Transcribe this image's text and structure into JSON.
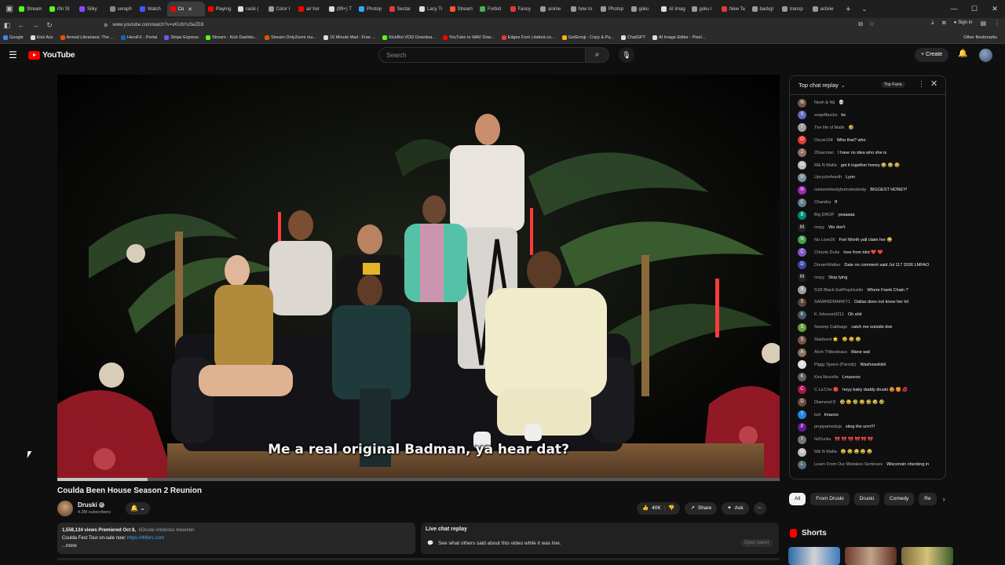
{
  "browser": {
    "tabs": [
      {
        "label": "Stream",
        "color": "#53fc18",
        "active": false
      },
      {
        "label": "r0n St",
        "color": "#53fc18",
        "active": false
      },
      {
        "label": "Silky",
        "color": "#9146ff",
        "active": false
      },
      {
        "label": "seraph",
        "color": "#888888",
        "active": false
      },
      {
        "label": "Watch",
        "color": "#3d5afe",
        "active": false
      },
      {
        "label": "Co",
        "color": "#ff0000",
        "active": true
      },
      {
        "label": "Playing",
        "color": "#ff0000",
        "active": false
      },
      {
        "label": "racki (",
        "color": "#dddddd",
        "active": false
      },
      {
        "label": "Color I",
        "color": "#999999",
        "active": false
      },
      {
        "label": "air hor",
        "color": "#ff0000",
        "active": false
      },
      {
        "label": "(99+) T",
        "color": "#dddddd",
        "active": false
      },
      {
        "label": "Photop",
        "color": "#31a8ff",
        "active": false
      },
      {
        "label": "Sectar",
        "color": "#e53935",
        "active": false
      },
      {
        "label": "Lacy Ti",
        "color": "#dddddd",
        "active": false
      },
      {
        "label": "Stream",
        "color": "#ff5722",
        "active": false
      },
      {
        "label": "Forbid",
        "color": "#4caf50",
        "active": false
      },
      {
        "label": "Fancy",
        "color": "#e53935",
        "active": false
      },
      {
        "label": "anime",
        "color": "#999999",
        "active": false
      },
      {
        "label": "how to",
        "color": "#999999",
        "active": false
      },
      {
        "label": "Photop",
        "color": "#999999",
        "active": false
      },
      {
        "label": "goku",
        "color": "#999999",
        "active": false
      },
      {
        "label": "AI Imag",
        "color": "#dddddd",
        "active": false
      },
      {
        "label": "goku l",
        "color": "#999999",
        "active": false
      },
      {
        "label": "New Ta",
        "color": "#e53935",
        "active": false
      },
      {
        "label": "backgr",
        "color": "#999999",
        "active": false
      },
      {
        "label": "transp",
        "color": "#999999",
        "active": false
      },
      {
        "label": "activie",
        "color": "#999999",
        "active": false
      }
    ],
    "url": "www.youtube.com/watch?v=vKUbYuSeZE8",
    "signin_label": "Sign in",
    "bookmarks": [
      {
        "label": "Google",
        "color": "#4285f4"
      },
      {
        "label": "Kick Ass",
        "color": "#dddddd"
      },
      {
        "label": "Armed Librarians: The ...",
        "color": "#e65100"
      },
      {
        "label": "HeroFX - Portal",
        "color": "#1565c0"
      },
      {
        "label": "Stripe Express",
        "color": "#635bff"
      },
      {
        "label": "Stream - Kick Dashbo...",
        "color": "#53fc18"
      },
      {
        "label": "Stream OnlyZenni mu...",
        "color": "#e65100"
      },
      {
        "label": "10 Minute Mail - Free ...",
        "color": "#dddddd"
      },
      {
        "label": "KickBot VOD Downloa...",
        "color": "#53fc18"
      },
      {
        "label": "YouTube to WAV Dow...",
        "color": "#ff0000"
      },
      {
        "label": "Edges Font | dafont.co...",
        "color": "#e53935"
      },
      {
        "label": "GetEmoji - Copy & Pa...",
        "color": "#ffb300"
      },
      {
        "label": "ChatGPT",
        "color": "#dddddd"
      },
      {
        "label": "AI Image Editor - Pixel...",
        "color": "#dddddd"
      }
    ],
    "other_bookmarks": "Other Bookmarks"
  },
  "youtube": {
    "logo_text": "YouTube",
    "search_placeholder": "Search",
    "create_label": "+ Create"
  },
  "video": {
    "caption": "Me a real original Badman, ya hear dat?",
    "progress_fraction": 0.125,
    "title": "Coulda Been House Season 2 Reunion",
    "channel": "Druski",
    "subscribers": "4.3M subscribers",
    "likes": "40K",
    "share_label": "Share",
    "ask_label": "Ask",
    "views_line": "1,558,134 views  Premiered Oct 8,",
    "hashtags": "#Druski #rickross #reunion",
    "desc_text": "Coulda Fest Tour on-sale now: ",
    "desc_link": "https://4lifers.com",
    "more_label": "...more"
  },
  "live_replay": {
    "title": "Live chat replay",
    "subtitle": "See what others said about this video while it was live.",
    "button": "Open panel"
  },
  "chat": {
    "header": "Top chat replay",
    "top_fans": "Top Fans",
    "messages": [
      {
        "author": "Nesh & Nij",
        "text": "💀",
        "color": "#795548"
      },
      {
        "author": "snap4bucks",
        "text": "bs",
        "color": "#5c6bc0"
      },
      {
        "author": "The life of Malik",
        "text": "🤣",
        "color": "#9e9e9e"
      },
      {
        "author": "Oscar194",
        "text": "Who that? who",
        "color": "#e53935"
      },
      {
        "author": "20sacmac",
        "text": "I have no idea who she is",
        "color": "#8d6e63"
      },
      {
        "author": "M& N Mafia",
        "text": "get it together honey 😂 😂 😂",
        "color": "#bdbdbd"
      },
      {
        "author": "Upcycle4earth",
        "text": "Lyon",
        "color": "#78909c"
      },
      {
        "author": "notsomebodybutnotnobody",
        "text": "BIGGEST HONEY!",
        "color": "#9c27b0"
      },
      {
        "author": "Chandra",
        "text": "ff",
        "color": "#607d8b"
      },
      {
        "author": "Big DROP",
        "text": "yeaaaaa",
        "color": "#00897b"
      },
      {
        "author": "moyy",
        "text": "We don't",
        "color": "#212121"
      },
      {
        "author": "No Love26",
        "text": "Fort Worth yall claim her 😂",
        "color": "#43a047"
      },
      {
        "author": "Chizzle Dubz",
        "text": "love from tdot ❤️ ❤️",
        "color": "#7e57c2"
      },
      {
        "author": "DreamWalker",
        "text": "Date on comment said Jul 117 2026 LMFAO",
        "color": "#3949ab"
      },
      {
        "author": "moyy",
        "text": "Stop lying",
        "color": "#212121"
      },
      {
        "author": "S1R Black EatPrayHustle",
        "text": "Where Frank Chain ?",
        "color": "#9e9e9e"
      },
      {
        "author": "SAMANDMARKY1",
        "text": "Dallas does not know her lol",
        "color": "#5d4037"
      },
      {
        "author": "K Johnson0211",
        "text": "Oh shit",
        "color": "#455a64"
      },
      {
        "author": "Swamp Cabbage",
        "text": "catch me outside doe",
        "color": "#689f38"
      },
      {
        "author": "Starburst 🌟",
        "text": "😄 😄 😄",
        "color": "#795548"
      },
      {
        "author": "Alvin Thibodeaux",
        "text": "Mane wat",
        "color": "#8d6e63"
      },
      {
        "author": "Piggy Spanx (Parody)",
        "text": "Washowskiiiii",
        "color": "#e0e0e0"
      },
      {
        "author": "Kira Neuville",
        "text": "Lmaoooo",
        "color": "#616161"
      },
      {
        "author": "C.La'Che 🔴",
        "text": "heyy baby daddy druski 😍 🥰 💋",
        "color": "#ad1457"
      },
      {
        "author": "Diamond D",
        "text": "🤣 😂 🤣 😂 🤣 😂 🤣",
        "color": "#6d4c41"
      },
      {
        "author": "turt",
        "text": "lmaooo",
        "color": "#1e88e5"
      },
      {
        "author": "proppamedzja",
        "text": "skng the urrrr!!!",
        "color": "#6a1b9a"
      },
      {
        "author": "ItzDucku",
        "text": "🎀 🎀 🎀 🎀 🎀 🎀",
        "color": "#757575"
      },
      {
        "author": "M& N Mafia",
        "text": "😂 😂 😂 😂 😂",
        "color": "#bdbdbd"
      },
      {
        "author": "Learn From Our Mistakes Seminars",
        "text": "Wisconsin checking in",
        "color": "#546e7a"
      }
    ]
  },
  "chips": [
    "All",
    "From Druski",
    "Druski",
    "Comedy",
    "Re"
  ],
  "shorts_title": "Shorts",
  "colors": {
    "youtube_red": "#ff0000",
    "link_blue": "#3ea6ff",
    "background": "#0f0f0f"
  }
}
